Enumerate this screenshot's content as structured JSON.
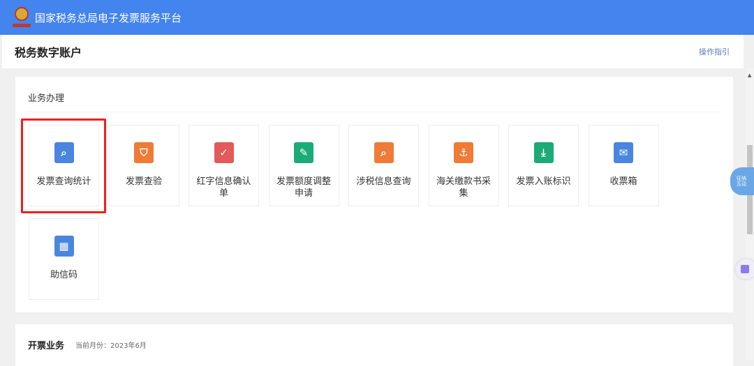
{
  "header": {
    "title": "国家税务总局电子发票服务平台",
    "logo": "tax-emblem"
  },
  "subheader": {
    "title": "税务数字账户",
    "guide_link": "操作指引"
  },
  "business": {
    "title": "业务办理",
    "items": [
      {
        "label": "发票查询统计",
        "icon": "document-search-icon",
        "color": "#4a86e0",
        "glyph": "⌕",
        "highlighted": true
      },
      {
        "label": "发票查验",
        "icon": "ticket-shield-icon",
        "color": "#ef7b37",
        "glyph": "⛉"
      },
      {
        "label": "红字信息确认单",
        "icon": "form-check-icon",
        "color": "#e35a5a",
        "glyph": "✓"
      },
      {
        "label": "发票额度调整申请",
        "icon": "edit-document-icon",
        "color": "#1bab78",
        "glyph": "✎"
      },
      {
        "label": "涉税信息查询",
        "icon": "folder-search-icon",
        "color": "#ef7b37",
        "glyph": "⌕"
      },
      {
        "label": "海关缴款书采集",
        "icon": "anchor-document-icon",
        "color": "#ef7b37",
        "glyph": "⚓"
      },
      {
        "label": "发票入账标识",
        "icon": "ticket-download-icon",
        "color": "#1bab78",
        "glyph": "⤓"
      },
      {
        "label": "收票箱",
        "icon": "envelope-icon",
        "color": "#4a86e0",
        "glyph": "✉"
      },
      {
        "label": "助信码",
        "icon": "qr-code-icon",
        "color": "#4a86e0",
        "glyph": "▦"
      }
    ]
  },
  "invoicing": {
    "title": "开票业务",
    "current_month": "当前月份：2023年6月"
  },
  "float": {
    "assistant_label": "征纳互动"
  }
}
